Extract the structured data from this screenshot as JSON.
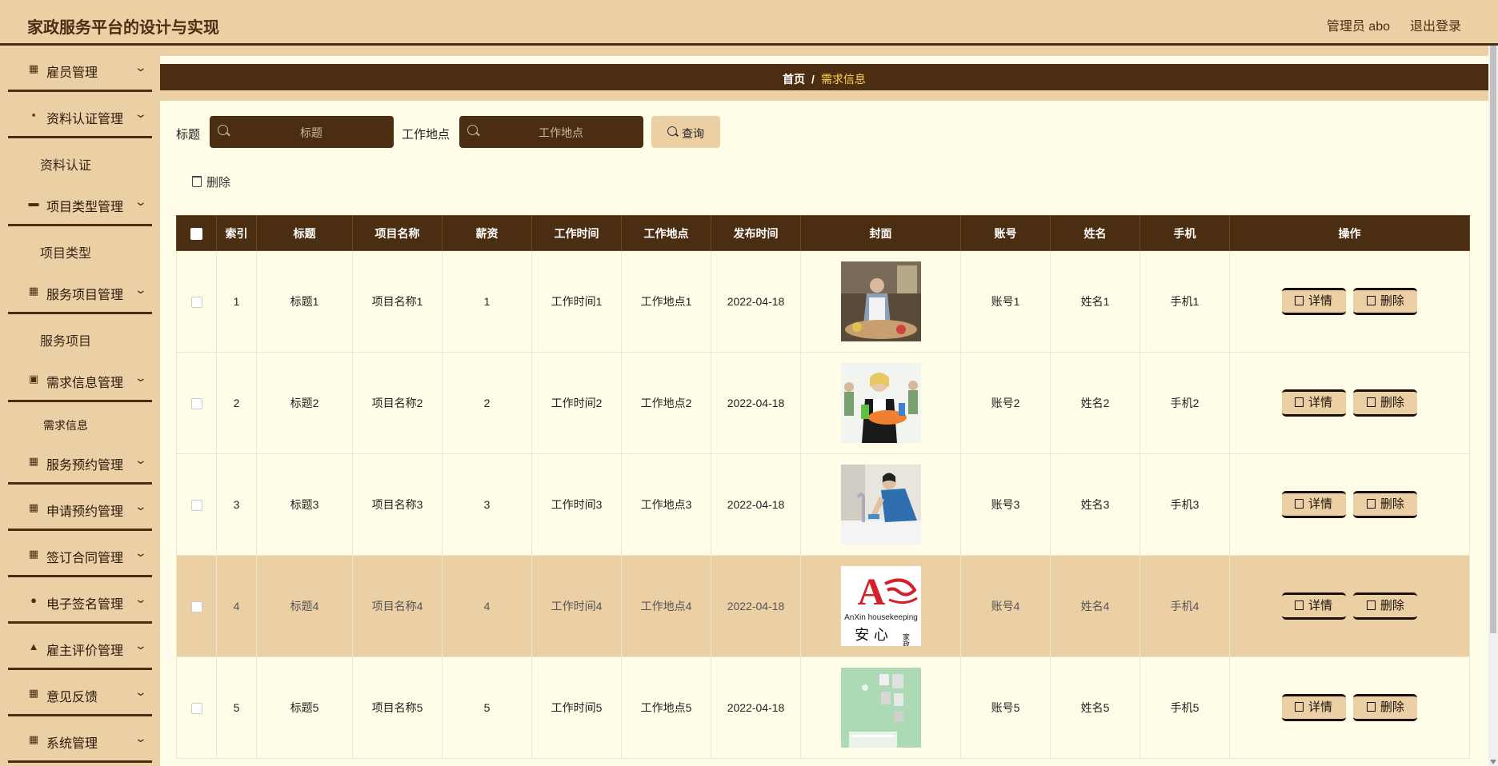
{
  "header": {
    "title": "家政服务平台的设计与实现",
    "user": "管理员 abo",
    "logout": "退出登录"
  },
  "sidebar": {
    "menus": [
      {
        "label": "雇员管理",
        "icon": "grid-icon"
      },
      {
        "label": "资料认证管理",
        "icon": "chat-icon",
        "sub": "资料认证"
      },
      {
        "label": "项目类型管理",
        "icon": "briefcase-icon",
        "sub": "项目类型"
      },
      {
        "label": "服务项目管理",
        "icon": "grid-icon",
        "sub": "服务项目"
      },
      {
        "label": "需求信息管理",
        "icon": "clipboard-icon",
        "sub": "需求信息"
      },
      {
        "label": "服务预约管理",
        "icon": "grid-icon"
      },
      {
        "label": "申请预约管理",
        "icon": "grid-icon"
      },
      {
        "label": "签订合同管理",
        "icon": "grid-icon"
      },
      {
        "label": "电子签名管理",
        "icon": "bulb-icon"
      },
      {
        "label": "雇主评价管理",
        "icon": "thumb-icon"
      },
      {
        "label": "意见反馈",
        "icon": "grid-icon"
      },
      {
        "label": "系统管理",
        "icon": "apps-icon"
      }
    ]
  },
  "breadcrumb": {
    "home": "首页",
    "separator": "/",
    "current": "需求信息"
  },
  "search": {
    "title_label": "标题",
    "title_placeholder": "标题",
    "location_label": "工作地点",
    "location_placeholder": "工作地点",
    "query_button": "查询"
  },
  "toolbar": {
    "delete_label": "删除"
  },
  "table": {
    "columns": [
      "索引",
      "标题",
      "项目名称",
      "薪资",
      "工作时间",
      "工作地点",
      "发布时间",
      "封面",
      "账号",
      "姓名",
      "手机",
      "操作"
    ],
    "rows": [
      {
        "index": "1",
        "title": "标题1",
        "project": "项目名称1",
        "salary": "1",
        "work_time": "工作时间1",
        "location": "工作地点1",
        "date": "2022-04-18",
        "account": "账号1",
        "name": "姓名1",
        "phone": "手机1"
      },
      {
        "index": "2",
        "title": "标题2",
        "project": "项目名称2",
        "salary": "2",
        "work_time": "工作时间2",
        "location": "工作地点2",
        "date": "2022-04-18",
        "account": "账号2",
        "name": "姓名2",
        "phone": "手机2"
      },
      {
        "index": "3",
        "title": "标题3",
        "project": "项目名称3",
        "salary": "3",
        "work_time": "工作时间3",
        "location": "工作地点3",
        "date": "2022-04-18",
        "account": "账号3",
        "name": "姓名3",
        "phone": "手机3"
      },
      {
        "index": "4",
        "title": "标题4",
        "project": "项目名称4",
        "salary": "4",
        "work_time": "工作时间4",
        "location": "工作地点4",
        "date": "2022-04-18",
        "account": "账号4",
        "name": "姓名4",
        "phone": "手机4",
        "cover_logo": {
          "brand_a": "A",
          "brand_name": "AnXin housekeeping",
          "brand_cn": "安 心",
          "brand_cn_small": "家政"
        }
      },
      {
        "index": "5",
        "title": "标题5",
        "project": "项目名称5",
        "salary": "5",
        "work_time": "工作时间5",
        "location": "工作地点5",
        "date": "2022-04-18",
        "account": "账号5",
        "name": "姓名5",
        "phone": "手机5"
      }
    ],
    "detail_label": "详情",
    "delete_label": "删除"
  },
  "colors": {
    "primary": "#4b2e12",
    "accent": "#ebcfa5",
    "content_bg": "#fffde7",
    "breadcrumb_current": "#ffd24d"
  }
}
